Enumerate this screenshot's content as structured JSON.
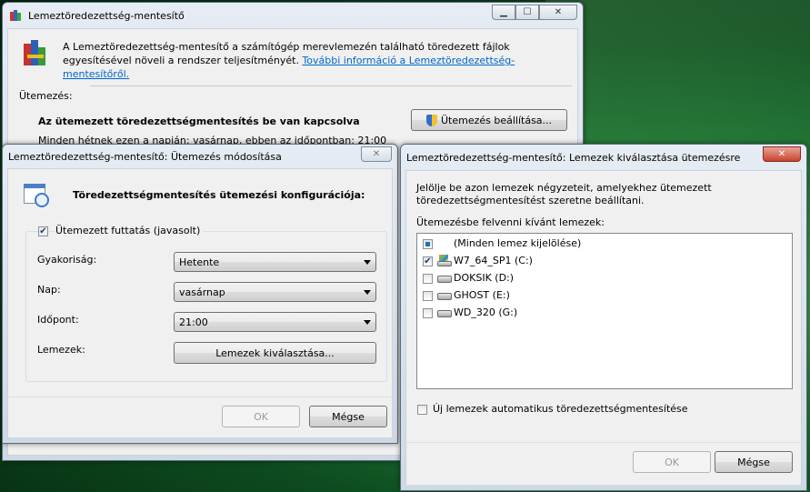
{
  "main_window": {
    "title": "Lemeztöredezettség-mentesítő",
    "description": "A Lemeztöredezettség-mentesítő a számítógép merevlemezén található töredezett fájlok egyesítésével növeli a rendszer teljesítményét.",
    "info_link": "További információ a Lemeztöredezettség-mentesítőről.",
    "schedule_heading": "Ütemezés:",
    "schedule_status": "Az ütemezett töredezettségmentesítés be van kapcsolva",
    "schedule_detail": "Minden hétnek ezen a napján: vasárnap, ebben az időpontban: 21:00",
    "schedule_button": "Ütemezés beállítása..."
  },
  "schedule_dialog": {
    "title": "Lemeztöredezettség-mentesítő: Ütemezés módosítása",
    "heading": "Töredezettségmentesítés ütemezési konfigurációja:",
    "run_scheduled_label": "Ütemezett futtatás (javasolt)",
    "run_scheduled_checked": true,
    "frequency_label": "Gyakoriság:",
    "frequency_value": "Hetente",
    "day_label": "Nap:",
    "day_value": "vasárnap",
    "time_label": "Időpont:",
    "time_value": "21:00",
    "disks_label": "Lemezek:",
    "select_disks_button": "Lemezek kiválasztása...",
    "ok_button": "OK",
    "cancel_button": "Mégse"
  },
  "disks_dialog": {
    "title": "Lemeztöredezettség-mentesítő: Lemezek kiválasztása ütemezésre",
    "instructions_line1": "Jelölje be azon lemezek négyzeteit, amelyekhez ütemezett",
    "instructions_line2": "töredezettségmentesítést szeretne beállítani.",
    "list_label": "Ütemezésbe felvenni kívánt lemezek:",
    "select_all": "(Minden lemez kijelölése)",
    "disks": [
      {
        "label": "W7_64_SP1 (C:)",
        "checked": true,
        "icon": "system-drive-icon"
      },
      {
        "label": "DOKSIK (D:)",
        "checked": false,
        "icon": "hard-drive-icon"
      },
      {
        "label": "GHOST (E:)",
        "checked": false,
        "icon": "hard-drive-icon"
      },
      {
        "label": "WD_320 (G:)",
        "checked": false,
        "icon": "hard-drive-icon"
      }
    ],
    "auto_new_disks": "Új lemezek automatikus töredezettségmentesítése",
    "ok_button": "OK",
    "cancel_button": "Mégse"
  },
  "colors": {
    "link": "#0066cc",
    "check": "#1c3b8a",
    "desktop": "#1f7a34"
  }
}
